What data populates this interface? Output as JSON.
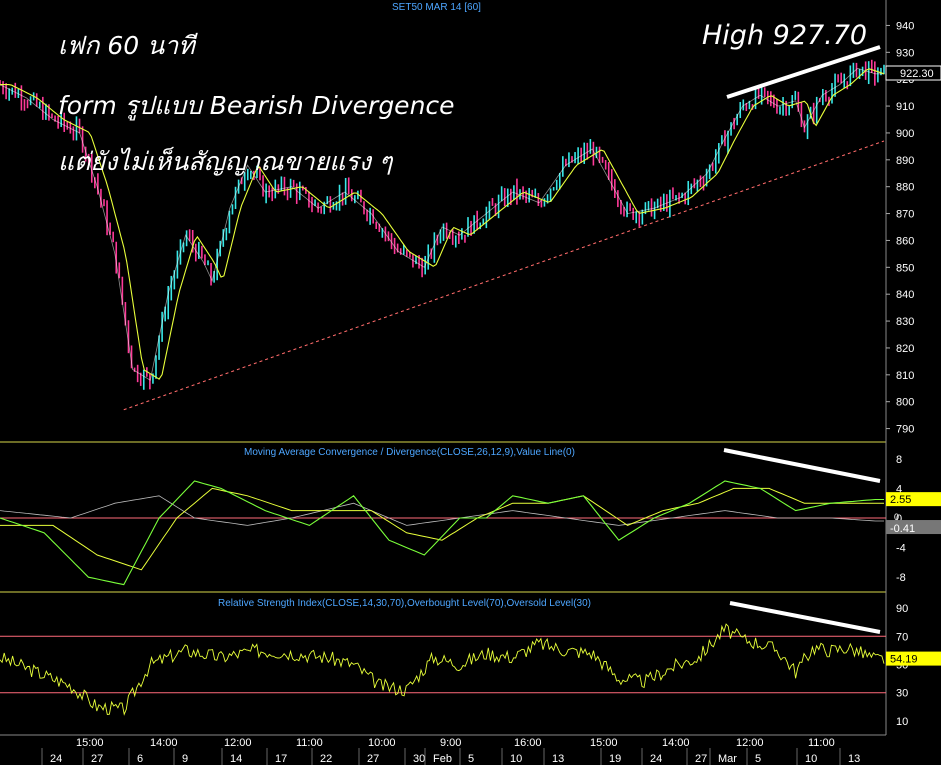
{
  "chart_data": [
    {
      "type": "candlestick",
      "title": "SET50 MAR 14  [60]",
      "ylim": [
        785,
        945
      ],
      "y_ticks": [
        "940",
        "930",
        "920",
        "910",
        "900",
        "890",
        "880",
        "870",
        "860",
        "850",
        "840",
        "830",
        "820",
        "810",
        "800",
        "790"
      ],
      "last_value": "922.30",
      "x_labels": [
        "24",
        "27",
        "6",
        "9",
        "14",
        "17",
        "22",
        "27",
        "30",
        "Feb",
        "5",
        "10",
        "13",
        "19",
        "24",
        "27",
        "Mar",
        "5",
        "10",
        "13"
      ],
      "time_labels": [
        "15:00",
        "14:00",
        "12:00",
        "11:00",
        "10:00",
        "9:00",
        "16:00",
        "15:00",
        "14:00",
        "12:00",
        "11:00"
      ],
      "trendline_support": [
        [
          0,
          797
        ],
        [
          1,
          897
        ]
      ],
      "close_path": [
        [
          0.0,
          918
        ],
        [
          0.03,
          913
        ],
        [
          0.06,
          905
        ],
        [
          0.09,
          900
        ],
        [
          0.11,
          880
        ],
        [
          0.13,
          855
        ],
        [
          0.15,
          812
        ],
        [
          0.17,
          808
        ],
        [
          0.19,
          840
        ],
        [
          0.21,
          862
        ],
        [
          0.23,
          852
        ],
        [
          0.24,
          845
        ],
        [
          0.26,
          872
        ],
        [
          0.28,
          888
        ],
        [
          0.3,
          878
        ],
        [
          0.33,
          880
        ],
        [
          0.36,
          872
        ],
        [
          0.39,
          878
        ],
        [
          0.42,
          870
        ],
        [
          0.45,
          856
        ],
        [
          0.48,
          850
        ],
        [
          0.5,
          865
        ],
        [
          0.52,
          862
        ],
        [
          0.55,
          870
        ],
        [
          0.58,
          878
        ],
        [
          0.61,
          874
        ],
        [
          0.64,
          888
        ],
        [
          0.67,
          894
        ],
        [
          0.69,
          882
        ],
        [
          0.71,
          870
        ],
        [
          0.74,
          872
        ],
        [
          0.77,
          876
        ],
        [
          0.8,
          885
        ],
        [
          0.82,
          898
        ],
        [
          0.84,
          910
        ],
        [
          0.86,
          914
        ],
        [
          0.88,
          910
        ],
        [
          0.9,
          912
        ],
        [
          0.91,
          902
        ],
        [
          0.93,
          914
        ],
        [
          0.95,
          918
        ],
        [
          0.97,
          924
        ],
        [
          0.99,
          922
        ]
      ]
    },
    {
      "type": "line",
      "title": "Moving Average Convergence / Divergence(CLOSE,26,12,9),Value Line(0)",
      "ylim": [
        -10,
        10
      ],
      "y_ticks": [
        "8",
        "4",
        "0",
        "-4",
        "-8"
      ],
      "value_labels": [
        "2.55",
        "0",
        "-0.41"
      ],
      "macd_path": [
        [
          0.0,
          0
        ],
        [
          0.05,
          -2
        ],
        [
          0.1,
          -8
        ],
        [
          0.14,
          -9
        ],
        [
          0.18,
          0
        ],
        [
          0.22,
          5
        ],
        [
          0.25,
          4
        ],
        [
          0.3,
          1
        ],
        [
          0.35,
          -1
        ],
        [
          0.4,
          3
        ],
        [
          0.44,
          -3
        ],
        [
          0.48,
          -5
        ],
        [
          0.52,
          0
        ],
        [
          0.55,
          0
        ],
        [
          0.58,
          3
        ],
        [
          0.62,
          2
        ],
        [
          0.66,
          3
        ],
        [
          0.7,
          -3
        ],
        [
          0.74,
          0
        ],
        [
          0.78,
          2
        ],
        [
          0.82,
          5
        ],
        [
          0.86,
          4
        ],
        [
          0.9,
          1
        ],
        [
          0.94,
          2
        ],
        [
          0.99,
          2.5
        ]
      ],
      "signal_path": [
        [
          0.0,
          -1
        ],
        [
          0.06,
          -1
        ],
        [
          0.11,
          -5
        ],
        [
          0.16,
          -7
        ],
        [
          0.2,
          0
        ],
        [
          0.24,
          4
        ],
        [
          0.28,
          3
        ],
        [
          0.33,
          1
        ],
        [
          0.38,
          1
        ],
        [
          0.42,
          1
        ],
        [
          0.46,
          -2
        ],
        [
          0.5,
          -3
        ],
        [
          0.54,
          0
        ],
        [
          0.58,
          2
        ],
        [
          0.62,
          2
        ],
        [
          0.66,
          3
        ],
        [
          0.71,
          -1
        ],
        [
          0.75,
          1
        ],
        [
          0.79,
          2
        ],
        [
          0.83,
          4
        ],
        [
          0.87,
          4
        ],
        [
          0.91,
          2
        ],
        [
          0.95,
          2
        ],
        [
          0.99,
          2
        ]
      ],
      "histogram_path": [
        [
          0.0,
          1
        ],
        [
          0.08,
          0
        ],
        [
          0.13,
          2
        ],
        [
          0.18,
          3
        ],
        [
          0.22,
          0
        ],
        [
          0.28,
          -1
        ],
        [
          0.33,
          0
        ],
        [
          0.4,
          2
        ],
        [
          0.46,
          -1
        ],
        [
          0.52,
          0
        ],
        [
          0.58,
          1
        ],
        [
          0.64,
          0
        ],
        [
          0.7,
          -1
        ],
        [
          0.76,
          0
        ],
        [
          0.82,
          1
        ],
        [
          0.88,
          0
        ],
        [
          0.94,
          0
        ],
        [
          0.99,
          -0.4
        ]
      ]
    },
    {
      "type": "line",
      "title": "Relative Strength Index(CLOSE,14,30,70),Overbought Level(70),Oversold Level(30)",
      "ylim": [
        0,
        100
      ],
      "y_ticks": [
        "90",
        "70",
        "50",
        "30",
        "10"
      ],
      "overbought": 70,
      "oversold": 30,
      "last_value": "54.19",
      "rsi_path": [
        [
          0.0,
          55
        ],
        [
          0.04,
          45
        ],
        [
          0.08,
          35
        ],
        [
          0.11,
          20
        ],
        [
          0.14,
          18
        ],
        [
          0.17,
          50
        ],
        [
          0.21,
          60
        ],
        [
          0.25,
          55
        ],
        [
          0.29,
          60
        ],
        [
          0.33,
          58
        ],
        [
          0.37,
          55
        ],
        [
          0.4,
          50
        ],
        [
          0.43,
          35
        ],
        [
          0.46,
          32
        ],
        [
          0.49,
          55
        ],
        [
          0.52,
          50
        ],
        [
          0.55,
          58
        ],
        [
          0.58,
          55
        ],
        [
          0.61,
          65
        ],
        [
          0.64,
          60
        ],
        [
          0.67,
          58
        ],
        [
          0.7,
          40
        ],
        [
          0.73,
          38
        ],
        [
          0.76,
          48
        ],
        [
          0.79,
          55
        ],
        [
          0.82,
          75
        ],
        [
          0.84,
          68
        ],
        [
          0.86,
          65
        ],
        [
          0.88,
          60
        ],
        [
          0.9,
          45
        ],
        [
          0.92,
          62
        ],
        [
          0.94,
          60
        ],
        [
          0.96,
          62
        ],
        [
          0.99,
          54
        ]
      ]
    }
  ],
  "annotations": {
    "line1": "เฟก 60 นาที",
    "line2": "form รูปแบบ Bearish Divergence",
    "line3": "แต่ยังไม่เห็นสัญญาณขายแรง ๆ",
    "high": "High 927.70"
  },
  "colors": {
    "bull_candle": "#39e8e8",
    "bear_candle": "#ff3a9a",
    "ma": "#e8ff3a",
    "trendline": "#ff6b6b",
    "axis_text": "#ffffff",
    "title_text": "#4da6ff"
  }
}
